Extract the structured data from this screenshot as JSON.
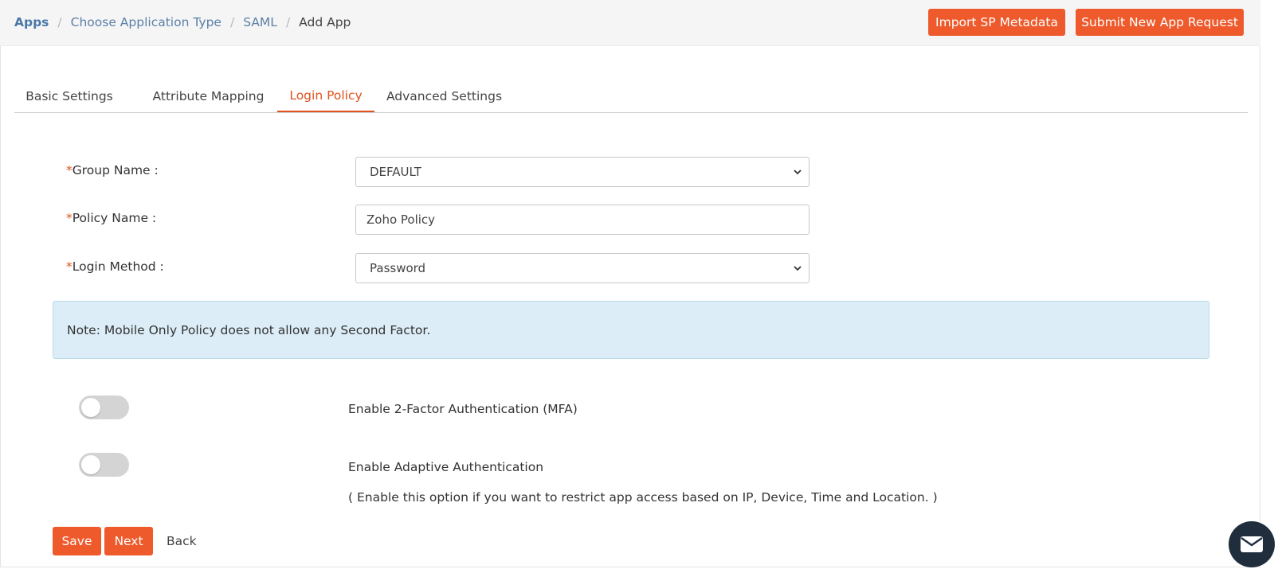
{
  "breadcrumb": {
    "items": [
      "Apps",
      "Choose Application Type",
      "SAML"
    ],
    "current": "Add App",
    "separator": "/"
  },
  "header_buttons": {
    "import": "Import SP Metadata",
    "submit": "Submit New App Request"
  },
  "tabs": [
    {
      "label": "Basic Settings",
      "active": false
    },
    {
      "label": "Attribute Mapping",
      "active": false
    },
    {
      "label": "Login Policy",
      "active": true
    },
    {
      "label": "Advanced Settings",
      "active": false
    }
  ],
  "form": {
    "required_mark": "*",
    "group_name": {
      "label": "Group Name :",
      "value": "DEFAULT"
    },
    "policy_name": {
      "label": "Policy Name :",
      "value": "Zoho Policy"
    },
    "login_method": {
      "label": "Login Method :",
      "value": "Password"
    }
  },
  "note": "Note: Mobile Only Policy does not allow any Second Factor.",
  "options": {
    "mfa": {
      "label": "Enable 2-Factor Authentication (MFA)",
      "enabled": false
    },
    "adaptive": {
      "label": "Enable Adaptive Authentication",
      "hint": "( Enable this option if you want to restrict app access based on IP, Device, Time and Location. )",
      "enabled": false
    }
  },
  "actions": {
    "save": "Save",
    "next": "Next",
    "back": "Back"
  },
  "colors": {
    "accent": "#ee5a2b",
    "link": "#4a77a8",
    "note_bg": "#dcedf7",
    "fab": "#1f2d3d"
  },
  "icons": {
    "chevron": "chevron-down-icon",
    "mail": "mail-icon"
  }
}
